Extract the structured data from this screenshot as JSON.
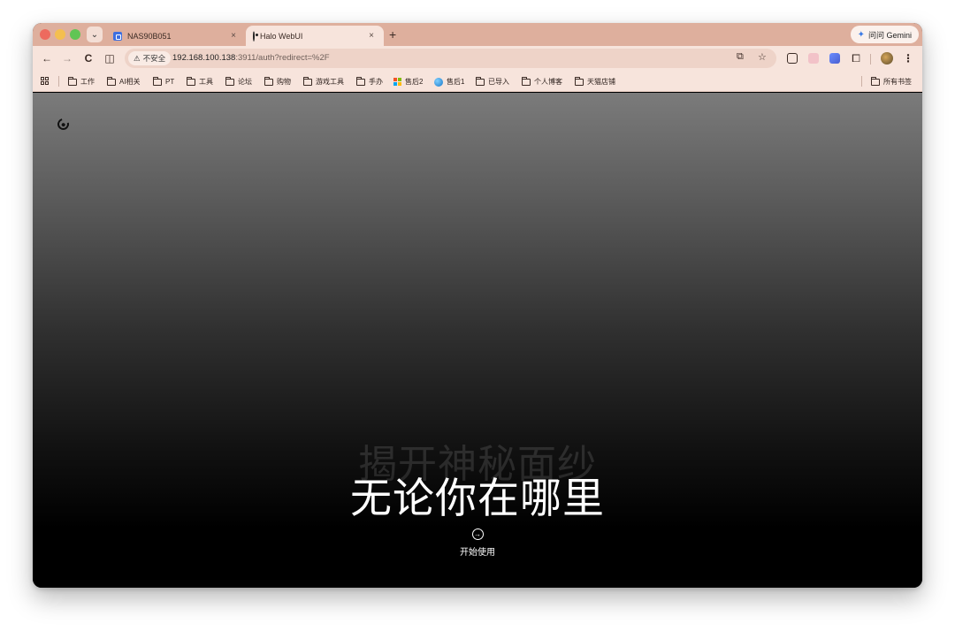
{
  "tabs": [
    {
      "title": "NAS90B051",
      "close": "×"
    },
    {
      "title": "Halo WebUI",
      "close": "×"
    }
  ],
  "new_tab_label": "+",
  "gemini_button": {
    "icon": "✦",
    "label": "问问 Gemini"
  },
  "toolbar": {
    "back_icon": "←",
    "forward_icon": "→",
    "reload_icon": "C",
    "split_icon": "◫",
    "security_icon": "⚠",
    "security_label": "不安全",
    "url_host": "192.168.100.138",
    "url_rest": ":3911/auth?redirect=%2F",
    "translate_icon": "⧉",
    "bookmark_star_icon": "☆",
    "extensions_icon": "⧠",
    "menu_icon": "⋮"
  },
  "bookmarks": [
    {
      "label": "工作",
      "icon": "folder-icon"
    },
    {
      "label": "AI相关",
      "icon": "folder-icon"
    },
    {
      "label": "PT",
      "icon": "folder-icon"
    },
    {
      "label": "工具",
      "icon": "folder-icon"
    },
    {
      "label": "论坛",
      "icon": "folder-icon"
    },
    {
      "label": "购物",
      "icon": "folder-icon"
    },
    {
      "label": "游戏工具",
      "icon": "folder-icon"
    },
    {
      "label": "手办",
      "icon": "folder-icon"
    },
    {
      "label": "售后2",
      "icon": "microsoft-icon"
    },
    {
      "label": "售后1",
      "icon": "globe-icon"
    },
    {
      "label": "已导入",
      "icon": "folder-icon"
    },
    {
      "label": "个人博客",
      "icon": "folder-icon"
    },
    {
      "label": "天猫店铺",
      "icon": "folder-icon"
    }
  ],
  "all_bookmarks_label": "所有书签",
  "hero": {
    "ghost_text": "揭开神秘面纱",
    "title": "无论你在哪里",
    "start_icon": "→",
    "start_label": "开始使用"
  }
}
